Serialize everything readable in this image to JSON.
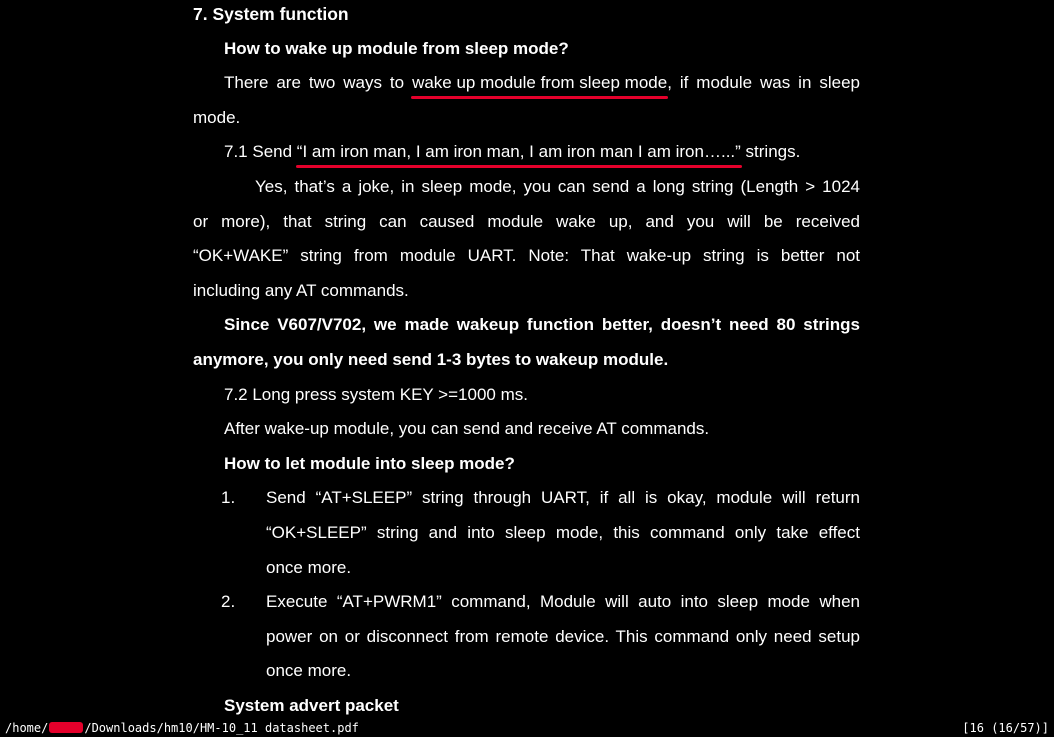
{
  "doc": {
    "heading": "7. System function",
    "sub1": "How to wake up module from sleep mode?",
    "p1_pre": "There are two ways to ",
    "p1_hl": "wake up module from sleep mode",
    "p1_post": ", if module was in sleep",
    "p1_line2": "mode.",
    "p2_pre": "7.1 Send ",
    "p2_hl": "“I am iron man, I am iron man, I am iron man I am iron…...”",
    "p2_post": " strings.",
    "p3_l1": "Yes, that’s a joke, in sleep mode, you can send a long string (Length > 1024",
    "p3_l2": "or more), that string can caused module wake up, and you will be received",
    "p3_l3": "“OK+WAKE” string from module UART. Note: That wake-up string is better not",
    "p3_l4": "including any AT commands.",
    "p4_l1": "Since V607/V702, we made wakeup function better, doesn’t need 80 strings",
    "p4_l2": "anymore, you only need send 1-3 bytes to wakeup module.",
    "p5": "7.2 Long press system KEY >=1000 ms.",
    "p6": "After wake-up module, you can send and receive AT commands.",
    "sub2": "How to let module into sleep mode?",
    "list": [
      {
        "num": "1.",
        "l1": "Send “AT+SLEEP” string through UART, if all is okay, module will return",
        "l2": "“OK+SLEEP” string and into sleep mode, this command only take effect",
        "l3": "once more."
      },
      {
        "num": "2.",
        "l1": "Execute “AT+PWRM1” command, Module will auto into sleep mode when",
        "l2": "power on or disconnect from remote device. This command only need setup",
        "l3": "once more."
      }
    ],
    "sub3": "System advert packet"
  },
  "status": {
    "path_prefix": "/home/",
    "path_suffix": "/Downloads/hm10/HM-10_11 datasheet.pdf",
    "page_info": "[16 (16/57)]"
  },
  "colors": {
    "highlight": "#e4002b",
    "background": "#000000",
    "text": "#ffffff"
  }
}
